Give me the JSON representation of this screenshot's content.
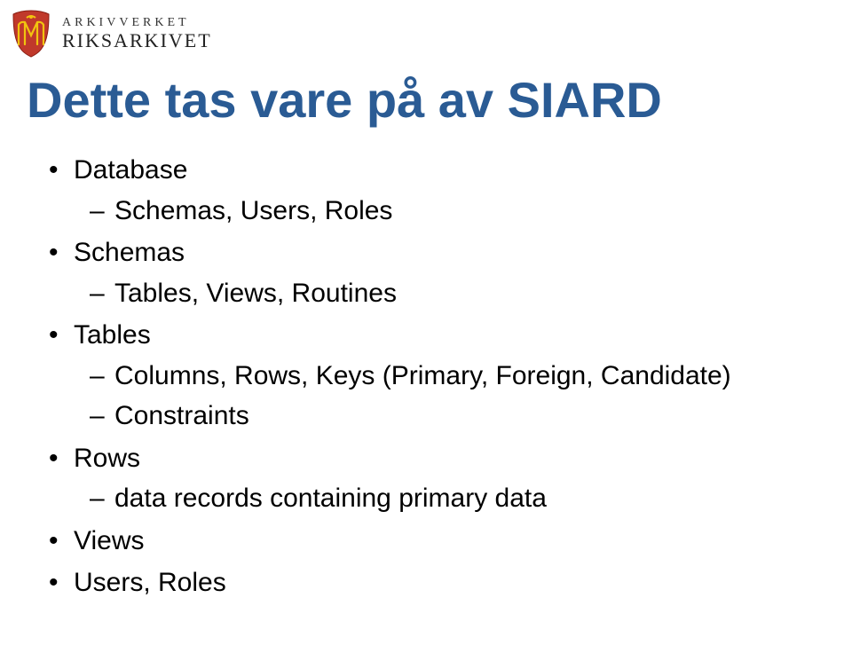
{
  "brand": {
    "top": "ARKIVVERKET",
    "bottom": "RIKSARKIVET"
  },
  "title": "Dette tas vare på av SIARD",
  "items": [
    {
      "label": "Database",
      "children": [
        {
          "label": "Schemas, Users, Roles"
        }
      ]
    },
    {
      "label": "Schemas",
      "children": [
        {
          "label": "Tables, Views, Routines"
        }
      ]
    },
    {
      "label": "Tables",
      "children": [
        {
          "label": "Columns, Rows, Keys (Primary, Foreign, Candidate)"
        },
        {
          "label": "Constraints"
        }
      ]
    },
    {
      "label": "Rows",
      "children": [
        {
          "label": "data records containing primary data"
        }
      ]
    },
    {
      "label": "Views"
    },
    {
      "label": "Users, Roles"
    }
  ]
}
